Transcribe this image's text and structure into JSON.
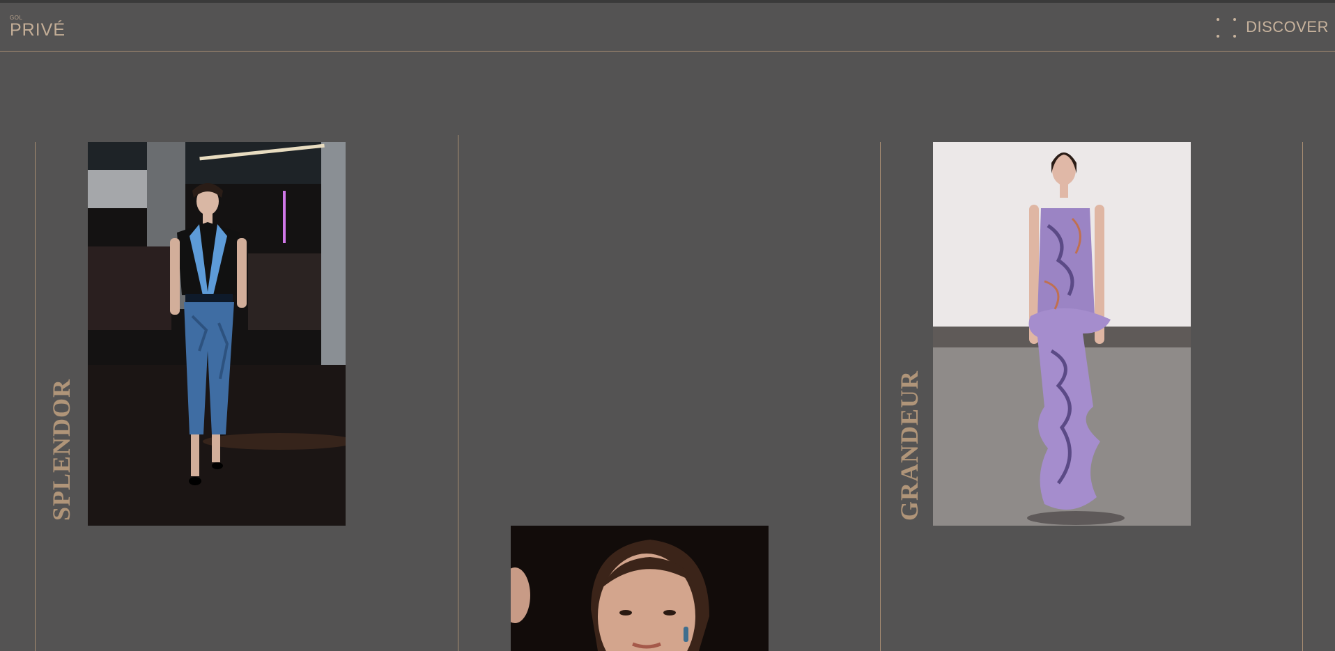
{
  "header": {
    "logo_small": "GOL",
    "logo_main": "PRIVÉ",
    "menu_icon": "grid-dots-icon",
    "discover_label": "DISCOVER"
  },
  "collections": [
    {
      "label": "SPLENDOR",
      "image": "model in black and blue tuxedo vest with blue pants"
    },
    {
      "label": "",
      "image": "close-up portrait of model"
    },
    {
      "label": "GRANDEUR",
      "image": "model in purple embroidered ruffled gown"
    }
  ],
  "colors": {
    "background": "#545353",
    "accent": "#a88d72",
    "label": "#b09579"
  }
}
